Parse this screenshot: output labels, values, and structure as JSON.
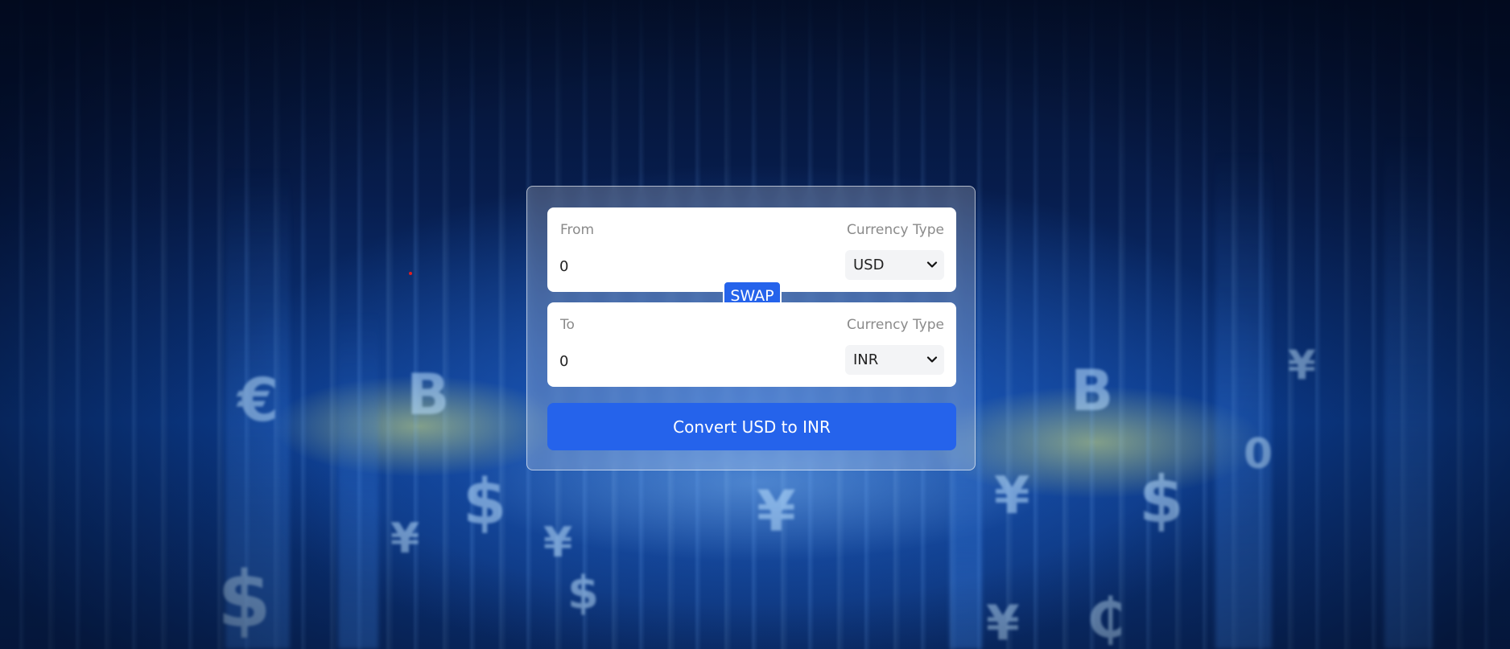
{
  "background": {
    "decorative_symbols": [
      "€",
      "B",
      "$",
      "¥",
      "¥",
      "$",
      "¥",
      "B",
      "¥",
      "$",
      "¥",
      "$",
      "0",
      "¥",
      "₵"
    ]
  },
  "converter": {
    "from": {
      "label": "From",
      "currency_type_label": "Currency Type",
      "amount": "0",
      "currency": "USD"
    },
    "swap_label": "SWAP",
    "to": {
      "label": "To",
      "currency_type_label": "Currency Type",
      "amount": "0",
      "currency": "INR"
    },
    "convert_label": "Convert USD to INR"
  },
  "colors": {
    "accent": "#2563eb",
    "card_border": "#ffffff",
    "field_bg": "#ffffff",
    "select_bg": "#f3f4f6"
  },
  "icons": {
    "select_chevron": "chevron-down-icon"
  }
}
